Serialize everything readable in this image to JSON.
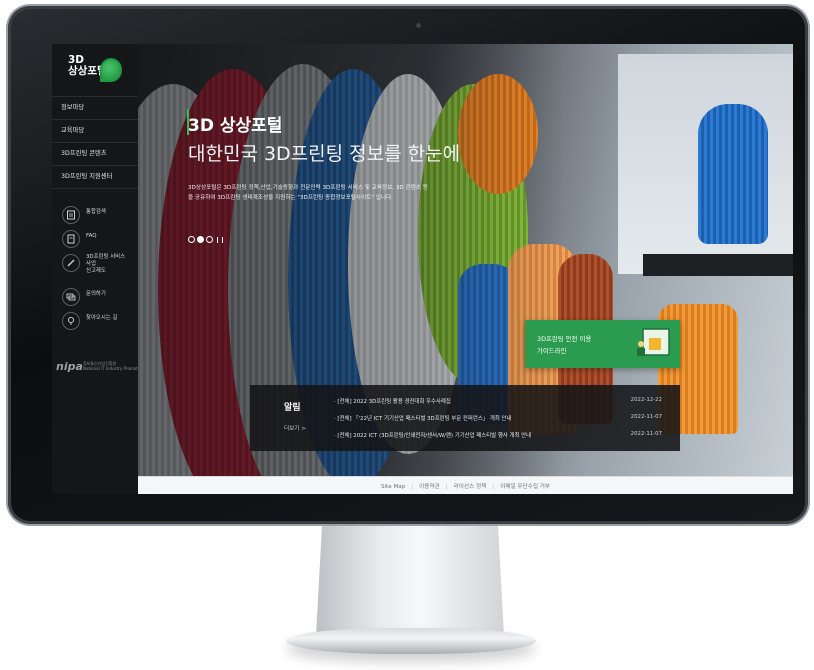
{
  "sidebar": {
    "logo": "3D\n상상포털",
    "menu": [
      "정보마당",
      "교육마당",
      "3D프린팅 콘텐츠",
      "3D프린팅 지원센터"
    ],
    "utilities": [
      {
        "icon": "book-icon",
        "label": "통합검색"
      },
      {
        "icon": "document-icon",
        "label": "FAQ"
      },
      {
        "icon": "pencil-icon",
        "label": "3D프린팅 서비스\n사업\n신고제도"
      },
      {
        "icon": "chat-icon",
        "label": "문의하기"
      },
      {
        "icon": "location-pin-icon",
        "label": "찾아오시는 길"
      }
    ],
    "nipa_logo": "nipa",
    "nipa_text": "정보통신산업진흥원\nNational IT Industry Promotion Agency"
  },
  "hero": {
    "title": "3D 상상포털",
    "subtitle": "대한민국 3D프린팅 정보를 한눈에",
    "description": "3D상상포털은 3D프린팅 정책,산업,기술동향과 전문인력 3D프린팅 서비스 및 교육정보, 3D 콘텐츠 등을 공유하여 3D프린팅 생태계조성을 지원하는 \"3D프린팅 종합정보포털사이트\" 입니다.",
    "slides": 3,
    "active_slide": 2
  },
  "guide_banner": {
    "label": "3D프린팅 안전 이용\n가이드라인"
  },
  "notice": {
    "title": "알림",
    "more": "더보기  >",
    "items": [
      {
        "title": "· [전체] 2022 3D프린팅 활용 경진대회 우수사례집",
        "date": "2022-12-22"
      },
      {
        "title": "· [전체] 「'22년 ICT 기기산업 페스티벌 3D프린팅 부문 컨퍼런스」 개최 안내",
        "date": "2022-11-07"
      },
      {
        "title": "· [전체] 2022 ICT (3D프린팅/인쇄전자/센서/W/랜) 기기산업 페스티벌 행사 개최 안내",
        "date": "2022-11-07"
      }
    ]
  },
  "footer": {
    "links": [
      "Site Map",
      "이용약관",
      "라이선스 정책",
      "이메일 무단수집 거부"
    ]
  },
  "colors": {
    "accent": "#2a9b4f",
    "sidebar_bg": "#151618"
  }
}
